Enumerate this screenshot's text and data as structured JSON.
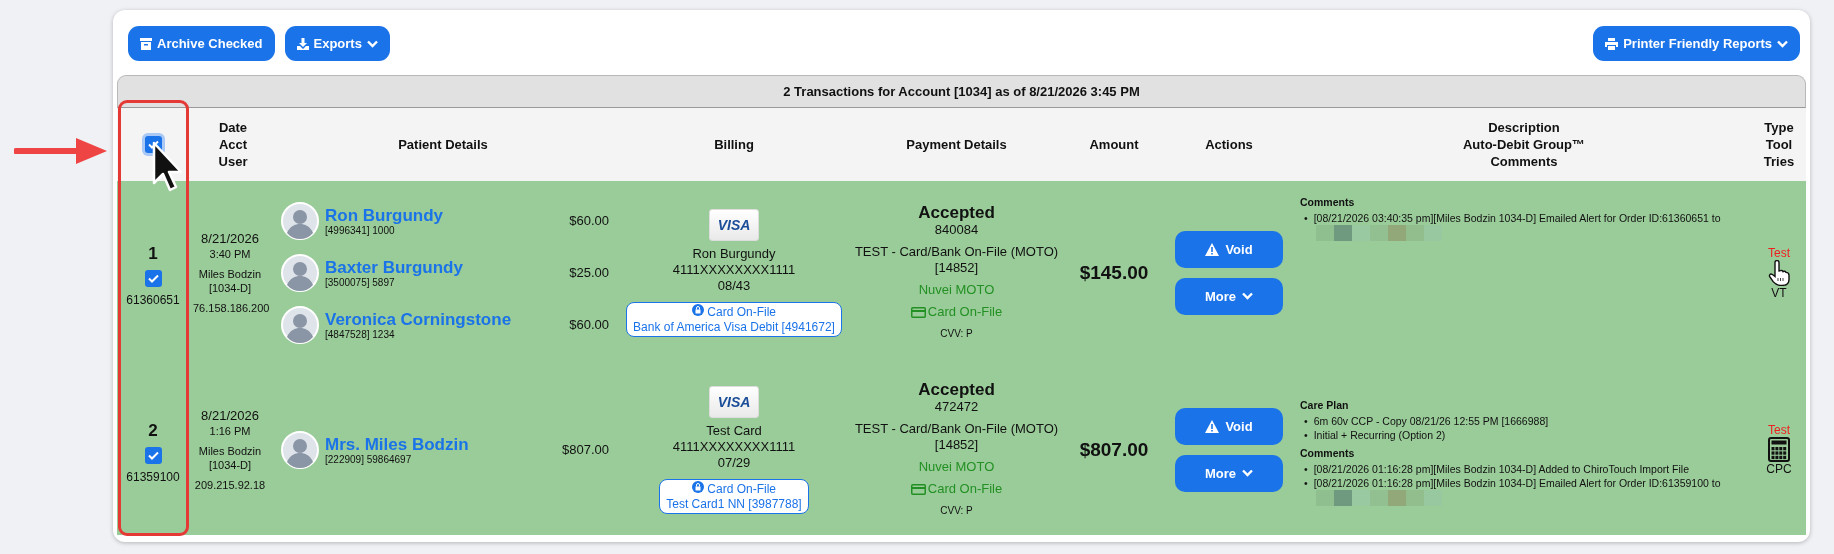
{
  "toolbar": {
    "buttons": [
      {
        "label": "Archive Checked",
        "dropdown": false
      },
      {
        "label": "Exports",
        "dropdown": true
      }
    ],
    "right_button": {
      "label": "Printer Friendly Reports",
      "dropdown": true
    }
  },
  "summary": "2 Transactions for Account [1034] as of 8/21/2026 3:45 PM",
  "header": {
    "select_all_checked": true,
    "columns": [
      [
        "Date",
        "Acct",
        "User"
      ],
      [
        "Patient Details"
      ],
      [
        "Billing"
      ],
      [
        "Payment Details"
      ],
      [
        "Amount"
      ],
      [
        "Actions"
      ],
      [
        "Description",
        "Auto-Debit Group™",
        "Comments"
      ],
      [
        "Type",
        "Tool",
        "Tries"
      ]
    ]
  },
  "rows": [
    {
      "index": "1",
      "checked": true,
      "order_id": "61360651",
      "date": "8/21/2026",
      "time": "3:40 PM",
      "user": "Miles Bodzin",
      "user_code": "[1034-D]",
      "ip": "76.158.186.200",
      "patients": [
        {
          "name": "Ron Burgundy",
          "ids": "[4996341] 1000",
          "amount": "$60.00"
        },
        {
          "name": "Baxter Burgundy",
          "ids": "[3500075] 5897",
          "amount": "$25.00"
        },
        {
          "name": "Veronica Corningstone",
          "ids": "[4847528] 1234",
          "amount": "$60.00"
        }
      ],
      "billing": {
        "brand": "VISA",
        "holder": "Ron Burgundy",
        "number": "4111XXXXXXXX1111",
        "expiry": "08/43",
        "on_file_label": "Card On-File",
        "on_file_detail": "Bank of America Visa Debit [4941672]"
      },
      "payment": {
        "status": "Accepted",
        "code": "840084",
        "method": "TEST - Card/Bank On-File (MOTO)",
        "method_code": "[14852]",
        "processor": "Nuvei MOTO",
        "source": "Card On-File",
        "cvv": "CVV: P"
      },
      "amount": "$145.00",
      "actions": [
        {
          "label": "Void",
          "kind": "void"
        },
        {
          "label": "More",
          "kind": "menu"
        }
      ],
      "description": [
        {
          "title": "Comments",
          "items": [
            {
              "marker": "•",
              "text": "[08/21/2026 03:40:35 pm][Miles Bodzin 1034-D] Emailed Alert for Order ID:61360651 to",
              "redacted": true
            }
          ]
        }
      ],
      "type": {
        "label": "Test",
        "kind": "manual",
        "tool": "VT"
      }
    },
    {
      "index": "2",
      "checked": true,
      "order_id": "61359100",
      "date": "8/21/2026",
      "time": "1:16 PM",
      "user": "Miles Bodzin",
      "user_code": "[1034-D]",
      "ip": "209.215.92.18",
      "patients": [
        {
          "name": "Mrs. Miles Bodzin",
          "ids": "[222909] 59864697",
          "amount": "$807.00"
        }
      ],
      "billing": {
        "brand": "VISA",
        "holder": "Test Card",
        "number": "4111XXXXXXXX1111",
        "expiry": "07/29",
        "on_file_label": "Card On-File",
        "on_file_detail": "Test Card1 NN [3987788]"
      },
      "payment": {
        "status": "Accepted",
        "code": "472472",
        "method": "TEST - Card/Bank On-File (MOTO)",
        "method_code": "[14852]",
        "processor": "Nuvei MOTO",
        "source": "Card On-File",
        "cvv": "CVV: P"
      },
      "amount": "$807.00",
      "actions": [
        {
          "label": "Void",
          "kind": "void"
        },
        {
          "label": "More",
          "kind": "menu"
        }
      ],
      "description": [
        {
          "title": "Care Plan",
          "items": [
            {
              "marker": "•",
              "text": "6m 60v CCP - Copy 08/21/26 12:55 PM [1666988]",
              "redacted": false
            },
            {
              "marker": "•",
              "text": "Initial + Recurring (Option 2)",
              "redacted": false
            }
          ]
        },
        {
          "title": "Comments",
          "items": [
            {
              "marker": "•",
              "text": "[08/21/2026 01:16:28 pm][Miles Bodzin 1034-D] Added to ChiroTouch Import File",
              "redacted": false
            },
            {
              "marker": "•",
              "text": "[08/21/2026 01:16:28 pm][Miles Bodzin 1034-D] Emailed Alert for Order ID:61359100 to",
              "redacted": true
            }
          ]
        }
      ],
      "type": {
        "label": "Test",
        "kind": "plan",
        "tool": "CPC"
      }
    }
  ]
}
